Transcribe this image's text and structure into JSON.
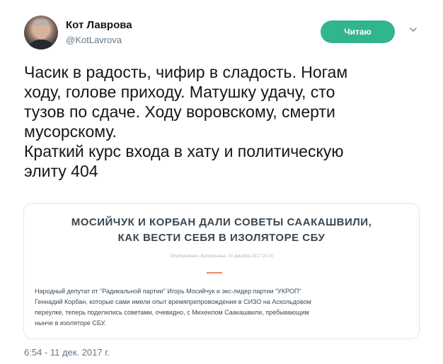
{
  "user": {
    "name": "Кот Лаврова",
    "handle": "@KotLavrova"
  },
  "follow_button": {
    "label": "Читаю",
    "color": "#31b58f"
  },
  "tweet": {
    "lines": [
      "Часик в радость, чифир в сладость. Ногам",
      "ходу, голове приходу. Матушку удачу, сто",
      "тузов по сдаче. Ходу воровскому, смерти",
      "мусорскому.",
      "Краткий курс входа в хату и политическую",
      "элиту 404"
    ]
  },
  "card": {
    "title_lines": [
      "МОСИЙЧУК И КОРБАН ДАЛИ СОВЕТЫ СААКАШВИЛИ,",
      "КАК ВЕСТИ СЕБЯ В ИЗОЛЯТОРЕ СБУ"
    ],
    "meta": "Опубликовано: Воскресенье, 10 декабря 2017 22:16",
    "body_lines": [
      "Народный депутат от \"Радикальной партии\" Игорь Мосийчук и экс-лидер партии \"УКРОП\"",
      "Геннадий Корбан, которые сами имели опыт времяпрепровождения в СИЗО на Аскольдовом",
      "переулке, теперь поделились советами, очевидно, с Михеилом Саакашвили, пребывающим",
      "нынче в изоляторе СБУ."
    ],
    "accent_color": "#f0845a"
  },
  "timestamp": "6:54 - 11 дек. 2017 г."
}
